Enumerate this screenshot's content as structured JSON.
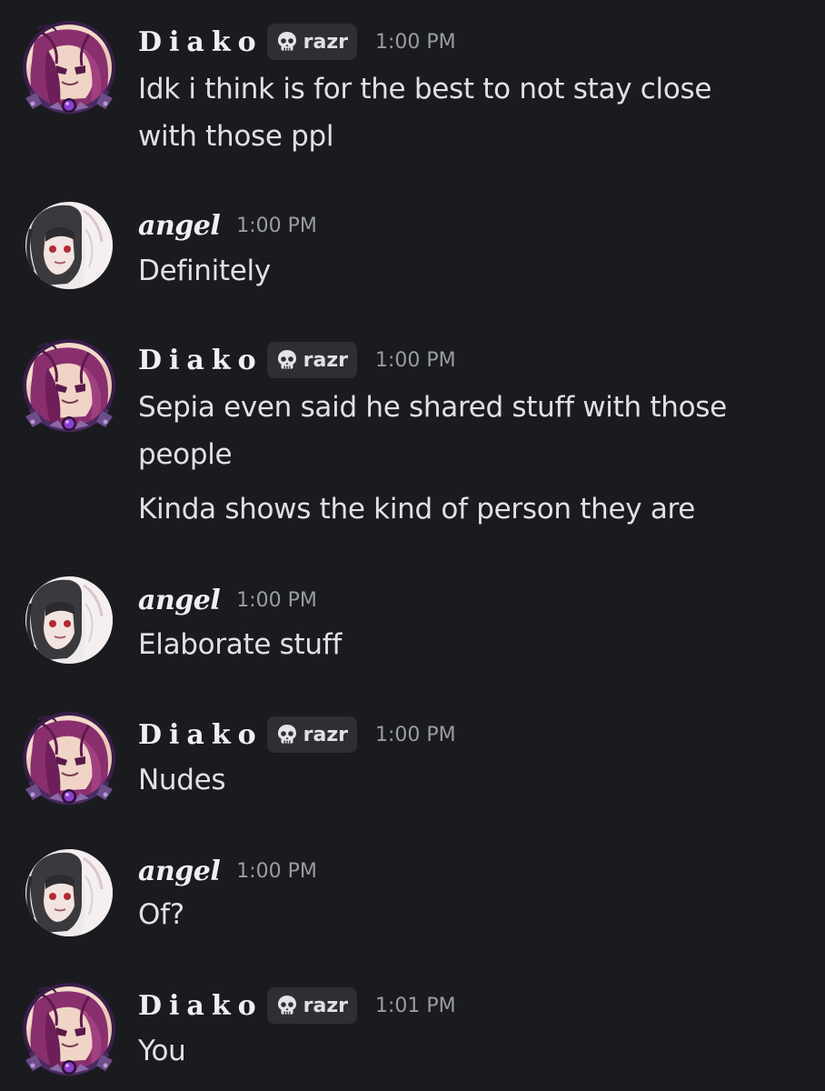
{
  "users": {
    "diako": {
      "name": "Diako",
      "tag": "razr",
      "tag_icon": "skull-icon",
      "avatar": "diako-avatar",
      "accent": "#7b3fa8"
    },
    "angel": {
      "name": "angel",
      "avatar": "angel-avatar"
    }
  },
  "messages": [
    {
      "author": "Diako",
      "tag": "razr",
      "time": "1:00 PM",
      "lines": [
        "Idk i think is for the best to not stay close",
        "with those ppl"
      ]
    },
    {
      "author": "angel",
      "time": "1:00 PM",
      "lines": [
        "Definitely"
      ]
    },
    {
      "author": "Diako",
      "tag": "razr",
      "time": "1:00 PM",
      "lines": [
        "Sepia even said he shared stuff with those",
        "people",
        "Kinda shows the kind of person they are"
      ]
    },
    {
      "author": "angel",
      "time": "1:00 PM",
      "lines": [
        "Elaborate stuff"
      ]
    },
    {
      "author": "Diako",
      "tag": "razr",
      "time": "1:00 PM",
      "lines": [
        "Nudes"
      ]
    },
    {
      "author": "angel",
      "time": "1:00 PM",
      "lines": [
        "Of?"
      ]
    },
    {
      "author": "Diako",
      "tag": "razr",
      "time": "1:01 PM",
      "lines": [
        "You"
      ]
    }
  ]
}
